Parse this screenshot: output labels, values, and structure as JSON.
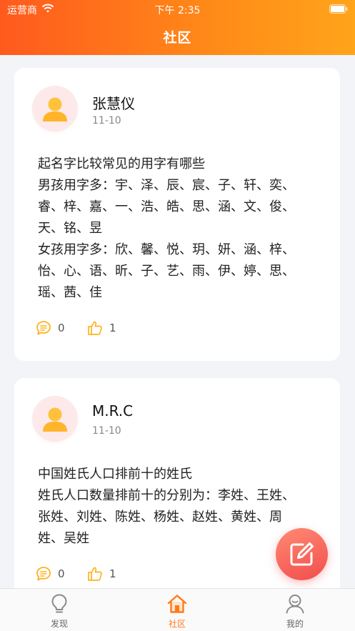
{
  "status_bar": {
    "carrier": "运营商",
    "time": "下午 2:35"
  },
  "header": {
    "title": "社区"
  },
  "posts": [
    {
      "username": "张慧仪",
      "date": "11-10",
      "content": "起名字比较常见的用字有哪些\n男孩用字多：宇、泽、辰、宸、子、轩、奕、睿、梓、嘉、一、浩、皓、思、涵、文、俊、天、铭、昱\n女孩用字多：欣、馨、悦、玥、妍、涵、梓、怡、心、语、昕、子、艺、雨、伊、婷、思、瑶、茜、佳",
      "comments": "0",
      "likes": "1"
    },
    {
      "username": "M.R.C",
      "date": "11-10",
      "content": "中国姓氏人口排前十的姓氏\n姓氏人口数量排前十的分别为：李姓、王姓、张姓、刘姓、陈姓、杨姓、赵姓、黄姓、周姓、吴姓",
      "comments": "0",
      "likes": "1"
    }
  ],
  "tabs": [
    {
      "label": "发现",
      "icon": "lightbulb-icon",
      "active": false
    },
    {
      "label": "社区",
      "icon": "home-icon",
      "active": true
    },
    {
      "label": "我的",
      "icon": "user-icon",
      "active": false
    }
  ],
  "colors": {
    "accent": "#ff7a1a",
    "fab": "#f25a55"
  }
}
